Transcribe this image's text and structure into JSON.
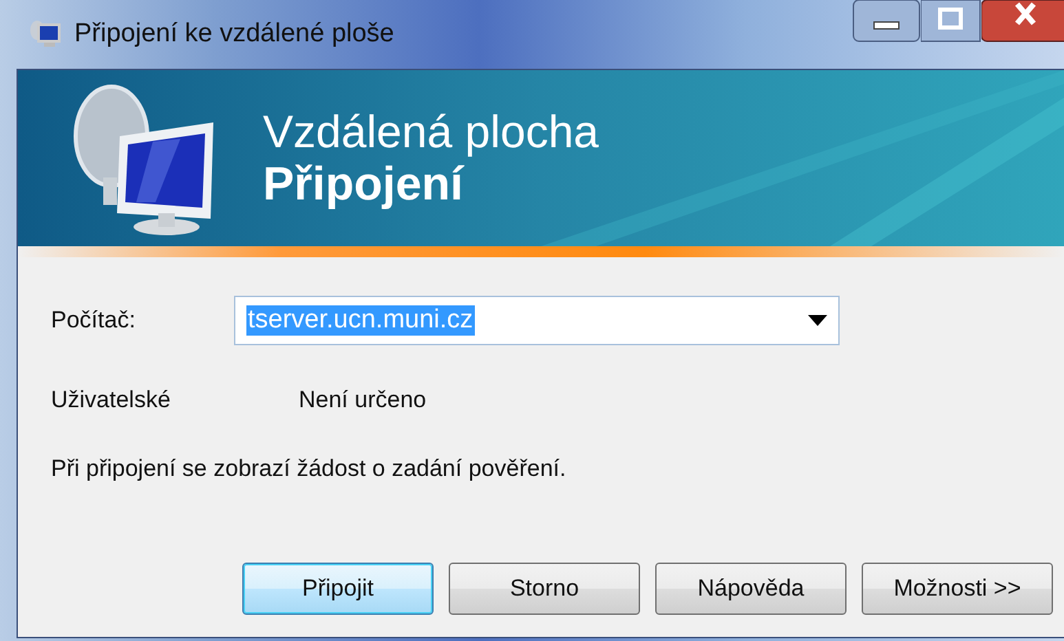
{
  "window": {
    "title": "Připojení ke vzdálené ploše"
  },
  "banner": {
    "subtitle": "Vzdálená plocha",
    "title": "Připojení"
  },
  "computer": {
    "label": "Počítač:",
    "value": "tserver.ucn.muni.cz",
    "value_selected": true
  },
  "user": {
    "label": "Uživatelské",
    "value": "Není určeno"
  },
  "message": "Při připojení se zobrazí žádost o zadání pověření.",
  "buttons": [
    {
      "label": "Připojit",
      "default": true
    },
    {
      "label": "Storno",
      "default": false
    },
    {
      "label": "Nápověda",
      "default": false
    },
    {
      "label": "Možnosti >>",
      "default": false
    }
  ]
}
